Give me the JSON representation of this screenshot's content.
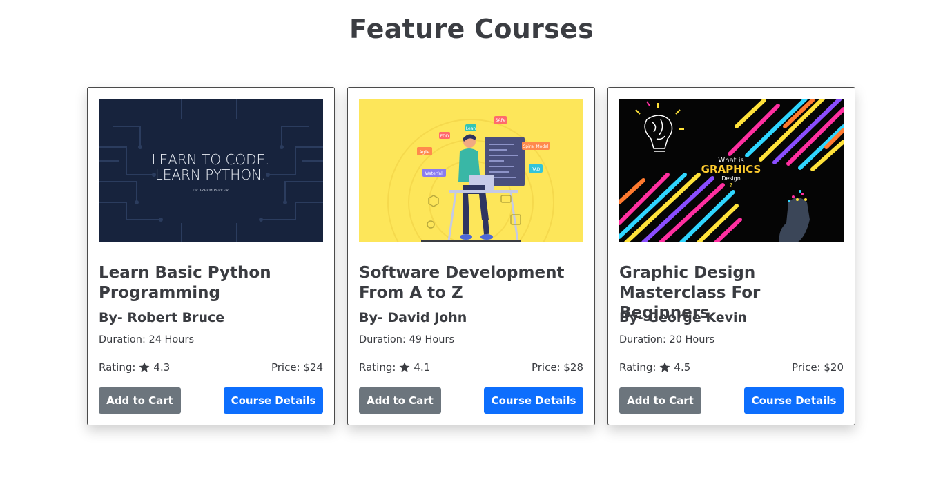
{
  "section": {
    "title": "Feature Courses"
  },
  "courses": [
    {
      "thumb": {
        "line1": "LEARN TO CODE.",
        "line2": "LEARN PYTHON.",
        "credit": "DR AZEEM PARKER"
      },
      "title": "Learn Basic Python Programming",
      "author": "By- Robert Bruce",
      "duration": "Duration: 24 Hours",
      "rating_label": "Rating:",
      "rating_value": "4.3",
      "price": "Price: $24",
      "cart_label": "Add to Cart",
      "details_label": "Course Details"
    },
    {
      "thumb": {
        "tags": [
          "FDD",
          "Lean",
          "SAFe",
          "Agile",
          "Spiral Model",
          "Waterfall",
          "RAD"
        ]
      },
      "title": "Software Development From A to Z",
      "author": "By- David John",
      "duration": "Duration: 49 Hours",
      "rating_label": "Rating:",
      "rating_value": "4.1",
      "price": "Price: $28",
      "cart_label": "Add to Cart",
      "details_label": "Course Details"
    },
    {
      "thumb": {
        "line1": "What is",
        "line2": "GRAPHICS",
        "line3": "Design",
        "mark": "?"
      },
      "title": "Graphic Design Masterclass For Beginners",
      "author": "By- George Kevin",
      "duration": "Duration: 20 Hours",
      "rating_label": "Rating:",
      "rating_value": "4.5",
      "price": "Price: $20",
      "cart_label": "Add to Cart",
      "details_label": "Course Details"
    }
  ],
  "colors": {
    "primary": "#0d6efd",
    "secondary": "#6c757d",
    "text": "#3a3c41"
  }
}
